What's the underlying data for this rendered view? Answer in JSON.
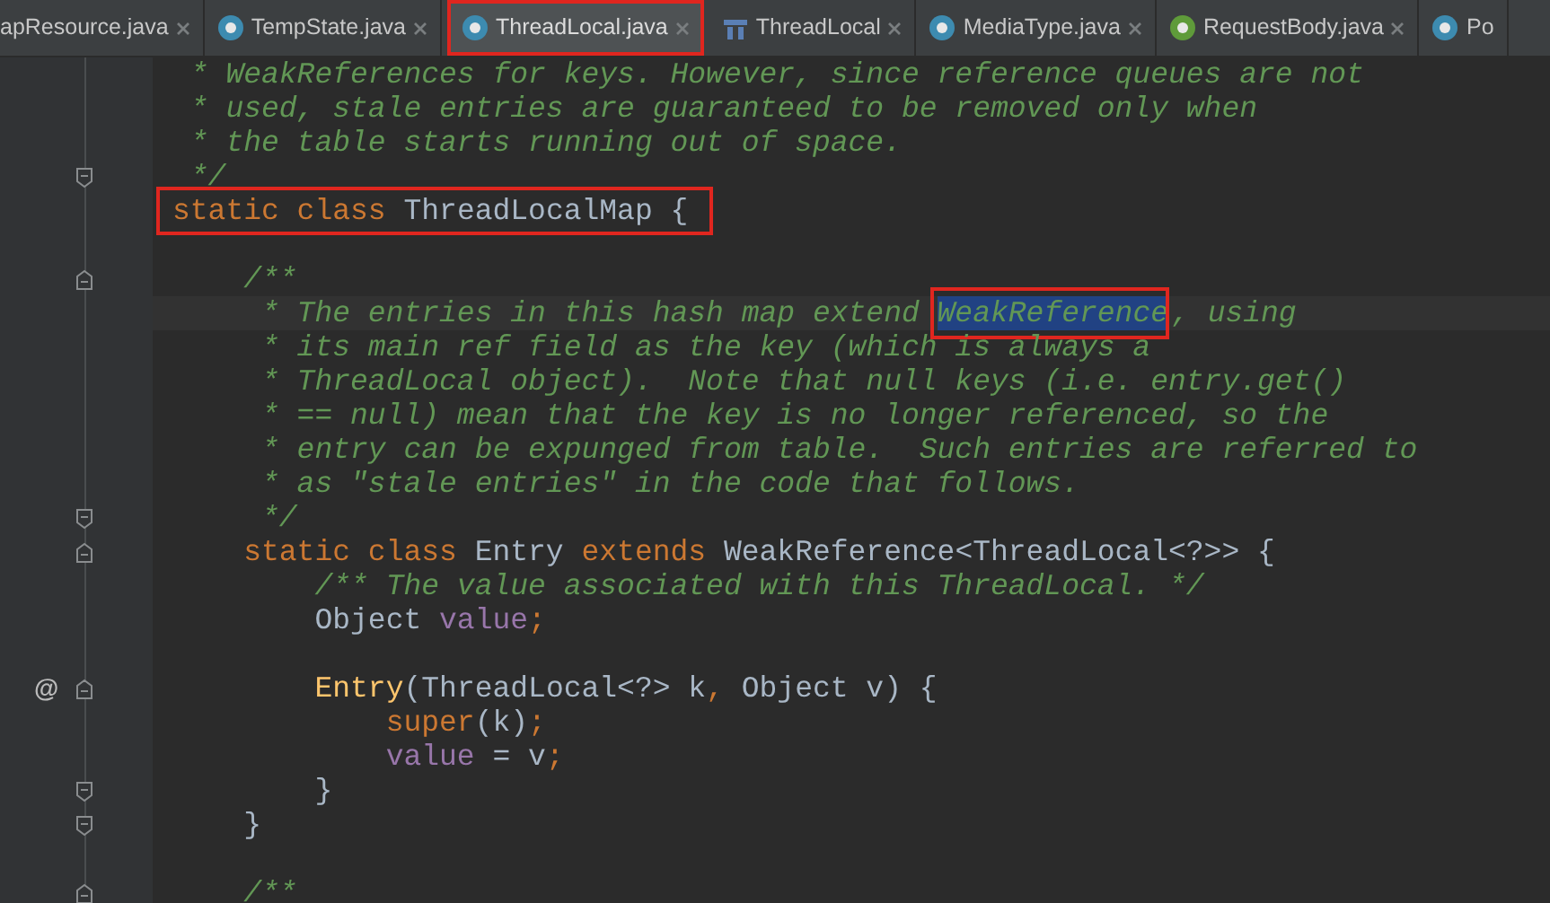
{
  "tabs": [
    {
      "label": "apResource.java",
      "kind": "plain",
      "selected": false,
      "annotated": false
    },
    {
      "label": "TempState.java",
      "kind": "class",
      "selected": false,
      "annotated": false
    },
    {
      "label": "ThreadLocal.java",
      "kind": "class",
      "selected": true,
      "annotated": true
    },
    {
      "label": "ThreadLocal",
      "kind": "structure",
      "selected": false,
      "annotated": false
    },
    {
      "label": "MediaType.java",
      "kind": "class",
      "selected": false,
      "annotated": false
    },
    {
      "label": "RequestBody.java",
      "kind": "annotation",
      "selected": false,
      "annotated": false
    },
    {
      "label": "Po",
      "kind": "enum-cut",
      "selected": false,
      "annotated": false
    }
  ],
  "lines": [
    {
      "kind": "plain",
      "segments": [
        {
          "text": " * WeakReferences for keys. However, since reference queues are not",
          "kind": "comment"
        }
      ]
    },
    {
      "kind": "plain",
      "segments": [
        {
          "text": " * used, stale entries are guaranteed to be removed only when",
          "kind": "comment"
        }
      ]
    },
    {
      "kind": "plain",
      "segments": [
        {
          "text": " * the table starts running out of space.",
          "kind": "comment"
        }
      ]
    },
    {
      "kind": "fold-end",
      "segments": [
        {
          "text": " */",
          "kind": "comment"
        }
      ]
    },
    {
      "kind": "plain",
      "annotated": true,
      "segments": [
        {
          "text": "static class ",
          "kind": "keyword"
        },
        {
          "text": "ThreadLocalMap {",
          "kind": "plain"
        }
      ]
    },
    {
      "kind": "plain"
    },
    {
      "kind": "fold-start",
      "segments": [
        {
          "text": "    /**",
          "kind": "comment"
        }
      ]
    },
    {
      "kind": "plain",
      "current": true,
      "segments": [
        {
          "text": "     * The entries in this hash map extend ",
          "kind": "comment"
        },
        {
          "text": "WeakReference",
          "kind": "comment",
          "selected": true,
          "annotated": true
        },
        {
          "text": ", using",
          "kind": "comment"
        }
      ]
    },
    {
      "kind": "plain",
      "segments": [
        {
          "text": "     * its main ref field as the key (which is always a",
          "kind": "comment"
        }
      ]
    },
    {
      "kind": "plain",
      "segments": [
        {
          "text": "     * ThreadLocal object).  Note that null keys (i.e. entry.get()",
          "kind": "comment"
        }
      ]
    },
    {
      "kind": "plain",
      "segments": [
        {
          "text": "     * == null) mean that the key is no longer referenced, so the",
          "kind": "comment"
        }
      ]
    },
    {
      "kind": "plain",
      "segments": [
        {
          "text": "     * entry can be expunged from table.  Such entries are referred to",
          "kind": "comment"
        }
      ]
    },
    {
      "kind": "plain",
      "segments": [
        {
          "text": "     * as \"stale entries\" in the code that follows.",
          "kind": "comment"
        }
      ]
    },
    {
      "kind": "fold-end",
      "segments": [
        {
          "text": "     */",
          "kind": "comment"
        }
      ]
    },
    {
      "kind": "fold-start",
      "segments": [
        {
          "text": "    static class ",
          "kind": "keyword"
        },
        {
          "text": "Entry ",
          "kind": "plain"
        },
        {
          "text": "extends ",
          "kind": "keyword"
        },
        {
          "text": "WeakReference<ThreadLocal<?>> {",
          "kind": "plain"
        }
      ]
    },
    {
      "kind": "plain",
      "segments": [
        {
          "text": "        /** The value associated with this ThreadLocal. */",
          "kind": "comment"
        }
      ]
    },
    {
      "kind": "plain",
      "segments": [
        {
          "text": "        Object ",
          "kind": "plain"
        },
        {
          "text": "value",
          "kind": "field"
        },
        {
          "text": ";",
          "kind": "keyword"
        }
      ]
    },
    {
      "kind": "plain"
    },
    {
      "kind": "fold-start",
      "gutter_mark": "@",
      "segments": [
        {
          "text": "        Entry",
          "kind": "method"
        },
        {
          "text": "(ThreadLocal<?> k",
          "kind": "plain"
        },
        {
          "text": ", ",
          "kind": "keyword"
        },
        {
          "text": "Object v) {",
          "kind": "plain"
        }
      ]
    },
    {
      "kind": "plain",
      "segments": [
        {
          "text": "            super",
          "kind": "keyword"
        },
        {
          "text": "(k)",
          "kind": "plain"
        },
        {
          "text": ";",
          "kind": "keyword"
        }
      ]
    },
    {
      "kind": "plain",
      "segments": [
        {
          "text": "            value",
          "kind": "field"
        },
        {
          "text": " = v",
          "kind": "plain"
        },
        {
          "text": ";",
          "kind": "keyword"
        }
      ]
    },
    {
      "kind": "fold-end",
      "segments": [
        {
          "text": "        }",
          "kind": "plain"
        }
      ]
    },
    {
      "kind": "fold-end",
      "segments": [
        {
          "text": "    }",
          "kind": "plain"
        }
      ]
    },
    {
      "kind": "plain"
    },
    {
      "kind": "fold-start",
      "segments": [
        {
          "text": "    /**",
          "kind": "comment"
        }
      ]
    }
  ]
}
